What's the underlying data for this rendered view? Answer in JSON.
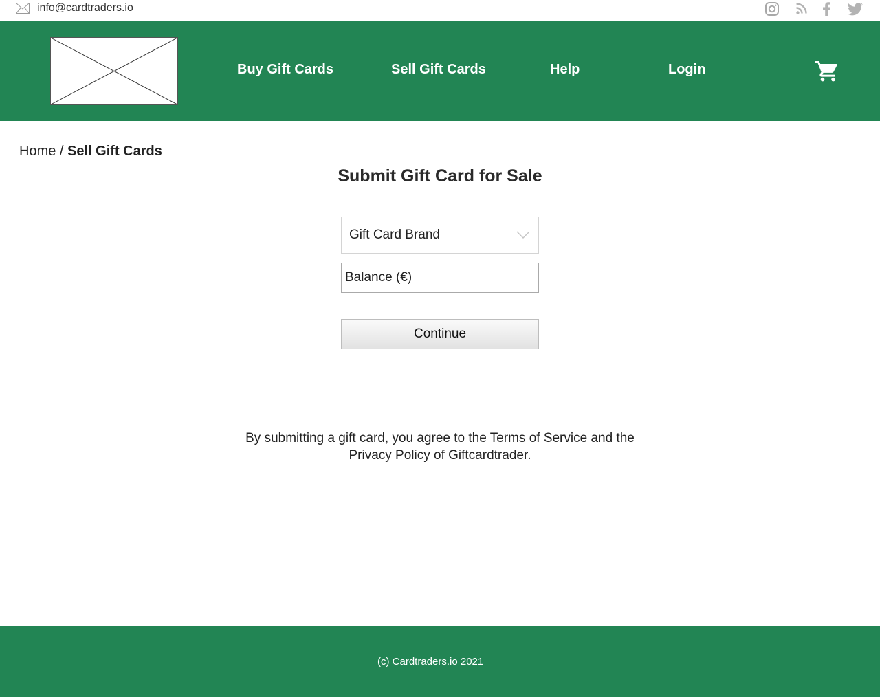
{
  "topbar": {
    "email": "info@cardtraders.io",
    "mail_icon": "mail-icon",
    "social_icons": [
      "instagram-icon",
      "rss-icon",
      "facebook-icon",
      "twitter-icon"
    ]
  },
  "header": {
    "nav": {
      "buy": "Buy Gift Cards",
      "sell": "Sell Gift Cards",
      "help": "Help",
      "login": "Login"
    },
    "cart_icon": "cart-icon",
    "background_color": "#228554"
  },
  "breadcrumb": {
    "home": "Home",
    "separator": " / ",
    "current": "Sell Gift Cards"
  },
  "page": {
    "title": "Submit Gift Card for Sale"
  },
  "form": {
    "brand_select": "Gift Card Brand",
    "balance_placeholder": "Balance (€)",
    "continue_label": "Continue"
  },
  "agreement": {
    "line1": "By submitting a gift card, you agree to the Terms of Service and the",
    "line2": "Privacy Policy of Giftcardtrader."
  },
  "footer": {
    "copyright": "(c) Cardtraders.io 2021"
  }
}
